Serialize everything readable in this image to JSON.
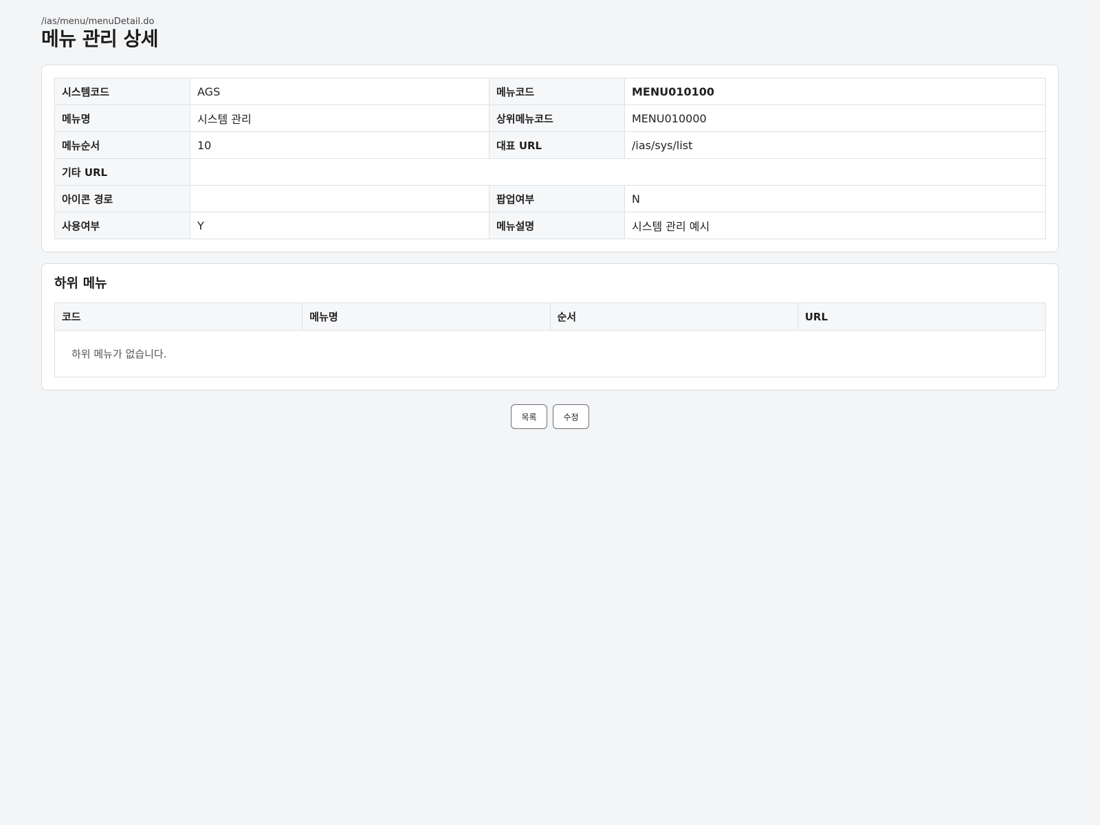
{
  "page": {
    "path": "/ias/menu/menuDetail.do",
    "title": "메뉴 관리 상세"
  },
  "detail": {
    "rows": [
      [
        {
          "label": "시스템코드",
          "value": "AGS"
        },
        {
          "label": "메뉴코드",
          "value": "MENU010100"
        }
      ],
      [
        {
          "label": "메뉴명",
          "value": "시스템 관리"
        },
        {
          "label": "상위메뉴코드",
          "value": "MENU010000"
        }
      ],
      [
        {
          "label": "메뉴순서",
          "value": "10"
        },
        {
          "label": "대표 URL",
          "value": "/ias/sys/list"
        }
      ],
      [
        {
          "label": "기타 URL",
          "value": ""
        }
      ],
      [
        {
          "label": "아이콘 경로",
          "value": ""
        },
        {
          "label": "팝업여부",
          "value": "N"
        }
      ],
      [
        {
          "label": "사용여부",
          "value": "Y"
        },
        {
          "label": "메뉴설명",
          "value": "시스템 관리 예시"
        }
      ]
    ]
  },
  "submenu": {
    "title": "하위 메뉴",
    "columns": [
      "코드",
      "메뉴명",
      "순서",
      "URL"
    ],
    "empty_message": "하위 메뉴가 없습니다."
  },
  "actions": {
    "list_label": "목록",
    "edit_label": "수정"
  }
}
